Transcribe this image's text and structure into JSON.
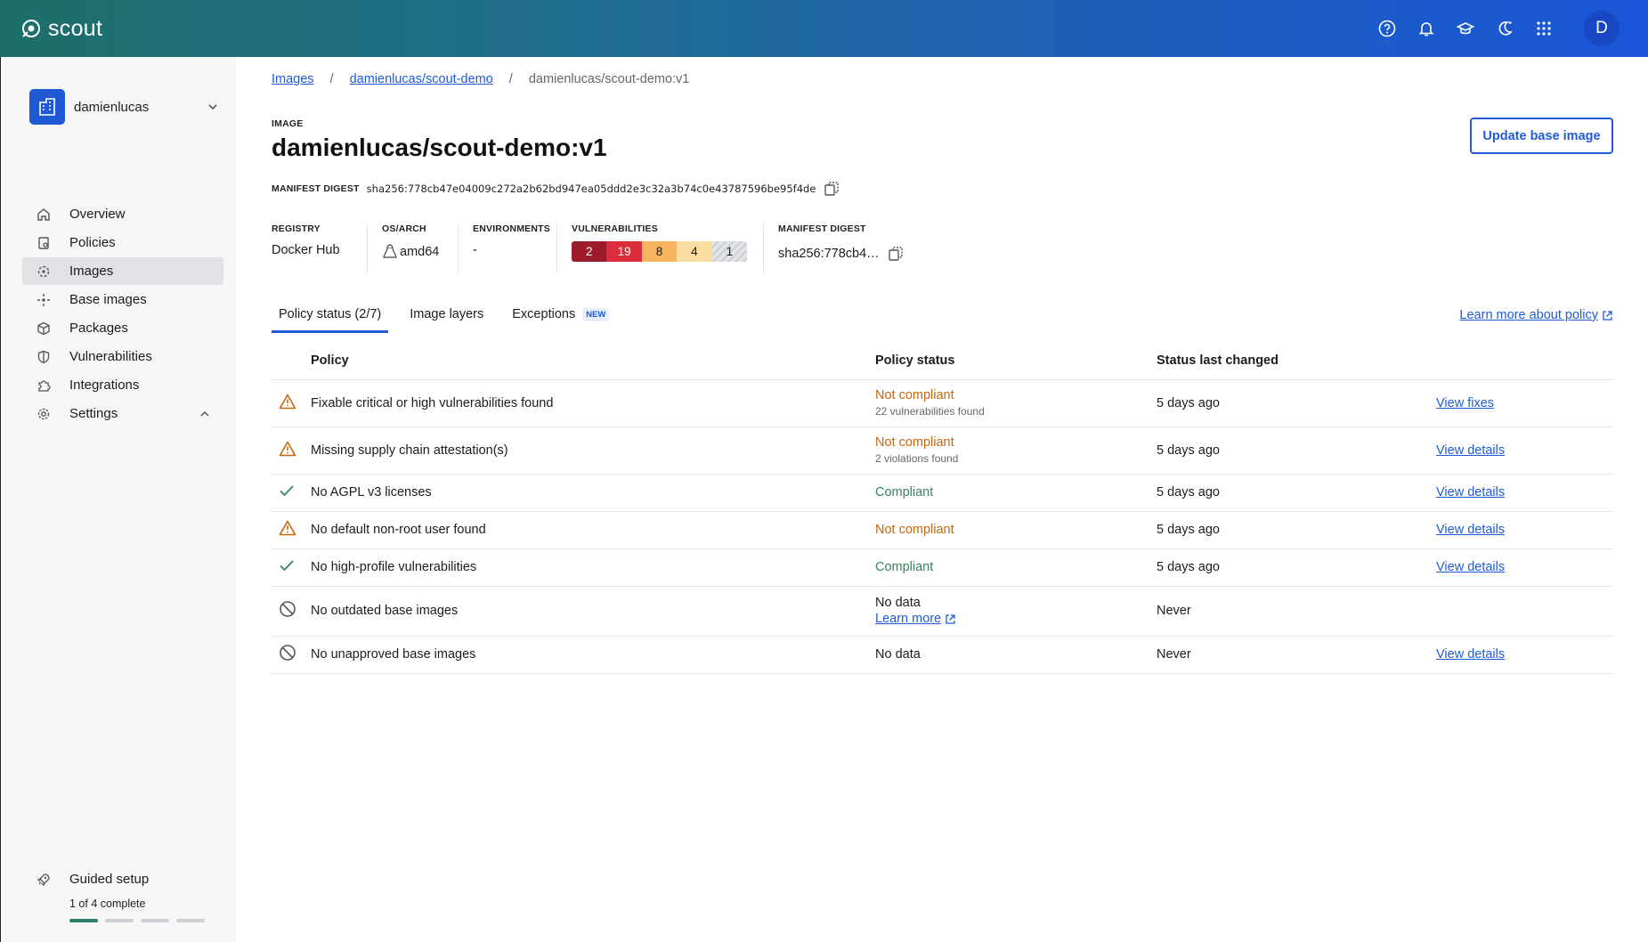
{
  "app": {
    "name": "scout"
  },
  "user": {
    "initial": "D"
  },
  "sidebar": {
    "org": "damienlucas",
    "items": [
      {
        "label": "Overview",
        "icon": "home-icon"
      },
      {
        "label": "Policies",
        "icon": "policy-icon"
      },
      {
        "label": "Images",
        "icon": "images-icon",
        "active": true
      },
      {
        "label": "Base images",
        "icon": "base-images-icon"
      },
      {
        "label": "Packages",
        "icon": "package-icon"
      },
      {
        "label": "Vulnerabilities",
        "icon": "shield-icon"
      },
      {
        "label": "Integrations",
        "icon": "puzzle-icon"
      },
      {
        "label": "Settings",
        "icon": "gear-icon"
      }
    ],
    "guided": {
      "title": "Guided setup",
      "progress_text": "1 of 4 complete",
      "steps_done": 1,
      "steps_total": 4
    }
  },
  "breadcrumb": {
    "root": "Images",
    "repo": "damienlucas/scout-demo",
    "current": "damienlucas/scout-demo:v1"
  },
  "image": {
    "label": "IMAGE",
    "title": "damienlucas/scout-demo:v1",
    "digest_label": "MANIFEST DIGEST",
    "digest": "sha256:778cb47e04009c272a2b62bd947ea05ddd2e3c32a3b74c0e43787596be95f4de"
  },
  "actions": {
    "update_base": "Update base image"
  },
  "meta": {
    "registry_label": "REGISTRY",
    "registry": "Docker Hub",
    "osarch_label": "OS/ARCH",
    "osarch": "amd64",
    "env_label": "ENVIRONMENTS",
    "env": "-",
    "vuln_label": "VULNERABILITIES",
    "vulns": {
      "critical": "2",
      "high": "19",
      "medium": "8",
      "low": "4",
      "unspecified": "1"
    },
    "digest_label": "MANIFEST DIGEST",
    "digest_short": "sha256:778cb4…"
  },
  "tabs": {
    "policy": "Policy status (2/7)",
    "layers": "Image layers",
    "exceptions": "Exceptions",
    "new_badge": "NEW",
    "learn_more": "Learn more about policy"
  },
  "table": {
    "headers": {
      "policy": "Policy",
      "status": "Policy status",
      "changed": "Status last changed"
    },
    "rows": [
      {
        "icon": "warning-icon",
        "policy": "Fixable critical or high vulnerabilities found",
        "status": "Not compliant",
        "sub": "22 vulnerabilities found",
        "changed": "5 days ago",
        "action": "View fixes"
      },
      {
        "icon": "warning-icon",
        "policy": "Missing supply chain attestation(s)",
        "status": "Not compliant",
        "sub": "2 violations found",
        "changed": "5 days ago",
        "action": "View details"
      },
      {
        "icon": "check-icon",
        "policy": "No AGPL v3 licenses",
        "status": "Compliant",
        "changed": "5 days ago",
        "action": "View details"
      },
      {
        "icon": "warning-icon",
        "policy": "No default non-root user found",
        "status": "Not compliant",
        "changed": "5 days ago",
        "action": "View details"
      },
      {
        "icon": "check-icon",
        "policy": "No high-profile vulnerabilities",
        "status": "Compliant",
        "changed": "5 days ago",
        "action": "View details"
      },
      {
        "icon": "no-data-icon",
        "policy": "No outdated base images",
        "status": "No data",
        "learn": "Learn more",
        "changed": "Never",
        "action": ""
      },
      {
        "icon": "no-data-icon",
        "policy": "No unapproved base images",
        "status": "No data",
        "changed": "Never",
        "action": "View details"
      }
    ]
  },
  "colors": {
    "accent": "#1f5bd6",
    "not_compliant": "#c8660a",
    "compliant": "#38835f",
    "critical": "#9e1b2b",
    "high": "#db2e3c",
    "medium": "#f7b45f",
    "low": "#fcdda1"
  }
}
